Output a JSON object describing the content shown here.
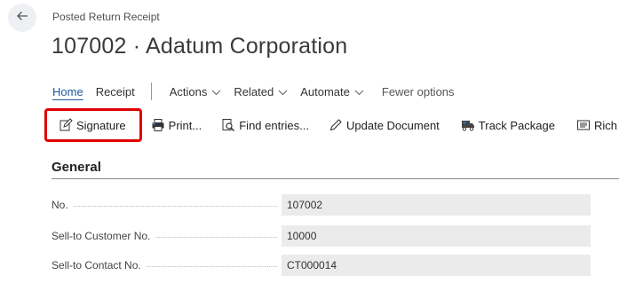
{
  "header": {
    "back_icon": "arrow-left-icon",
    "caption": "Posted Return Receipt",
    "title": "107002 · Adatum Corporation"
  },
  "actionbar": {
    "tabs": [
      {
        "label": "Home"
      },
      {
        "label": "Receipt"
      },
      {
        "label": "Actions"
      },
      {
        "label": "Related"
      },
      {
        "label": "Automate"
      },
      {
        "label": "Fewer options"
      }
    ]
  },
  "toolbar": {
    "buttons": [
      {
        "label": "Signature",
        "icon": "edit-document-icon"
      },
      {
        "label": "Print...",
        "icon": "printer-icon"
      },
      {
        "label": "Find entries...",
        "icon": "find-entries-icon"
      },
      {
        "label": "Update Document",
        "icon": "pencil-icon"
      },
      {
        "label": "Track Package",
        "icon": "truck-icon"
      },
      {
        "label": "Rich Text",
        "icon": "rich-text-icon"
      }
    ]
  },
  "general": {
    "title": "General",
    "fields": [
      {
        "label": "No.",
        "value": "107002"
      },
      {
        "label": "Sell-to Customer No.",
        "value": "10000"
      },
      {
        "label": "Sell-to Contact No.",
        "value": "CT000014"
      }
    ]
  },
  "colors": {
    "accent": "#1e5a9c",
    "highlight": "#e00000",
    "field_bg": "#ebebeb"
  }
}
